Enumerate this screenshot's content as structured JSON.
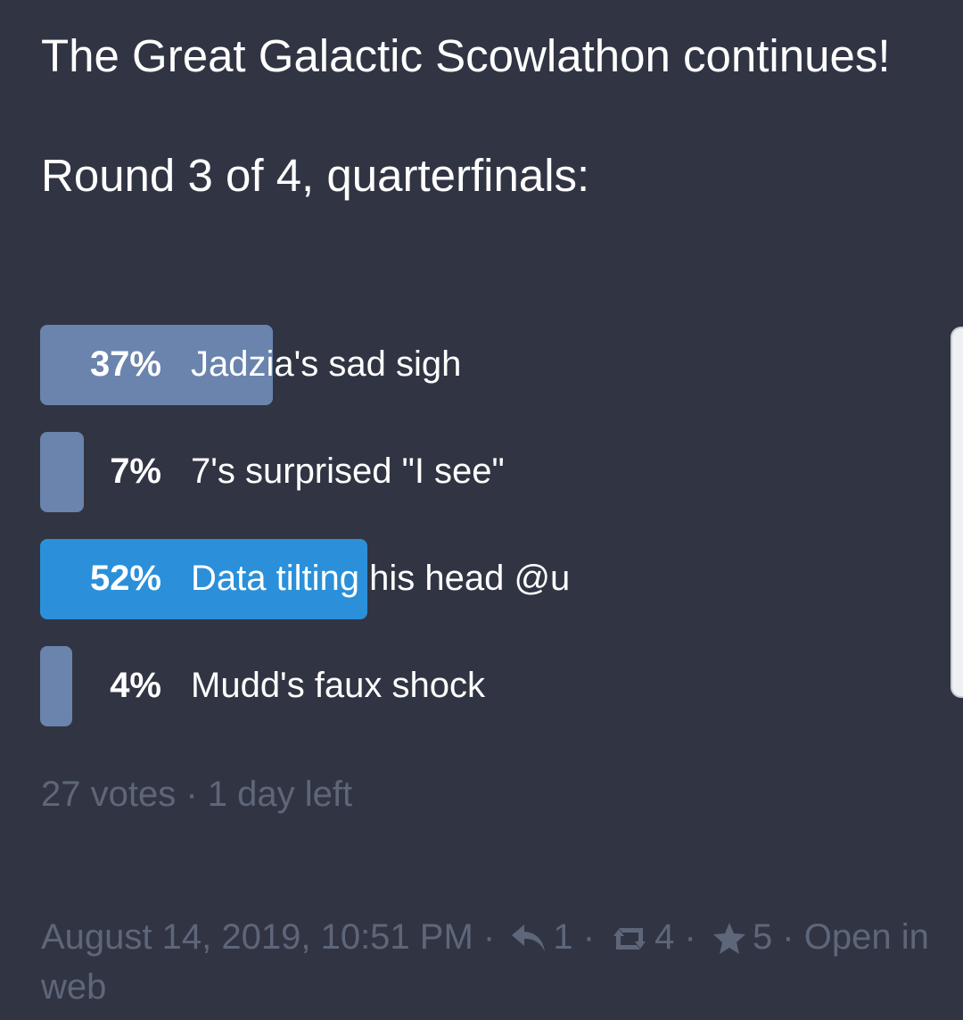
{
  "status": {
    "line1": "The Great Galactic Scowlathon continues!",
    "line2": "Round 3 of 4, quarterfinals:"
  },
  "poll": {
    "options": [
      {
        "percent_label": "37%",
        "percent": 37,
        "label": "Jadzia's sad sigh",
        "leading": false
      },
      {
        "percent_label": "7%",
        "percent": 7,
        "label": "7's surprised \"I see\"",
        "leading": false
      },
      {
        "percent_label": "52%",
        "percent": 52,
        "label": "Data tilting his head @u",
        "leading": true
      },
      {
        "percent_label": "4%",
        "percent": 4,
        "label": "Mudd's faux shock",
        "leading": false
      }
    ],
    "votes": "27 votes",
    "separator": " · ",
    "time_left": "1 day left"
  },
  "meta": {
    "timestamp": "August 14, 2019, 10:51 PM",
    "separator": " · ",
    "reply_icon": "reply-icon",
    "replies": "1",
    "boost_icon": "boost-icon",
    "boosts": "4",
    "favourite_icon": "star-icon",
    "favourites": "5",
    "open_in_web": "Open in web"
  },
  "colors": {
    "background": "#313543",
    "bar": "#6a84ad",
    "bar_leading": "#2b90d9",
    "muted": "#5e6679"
  }
}
